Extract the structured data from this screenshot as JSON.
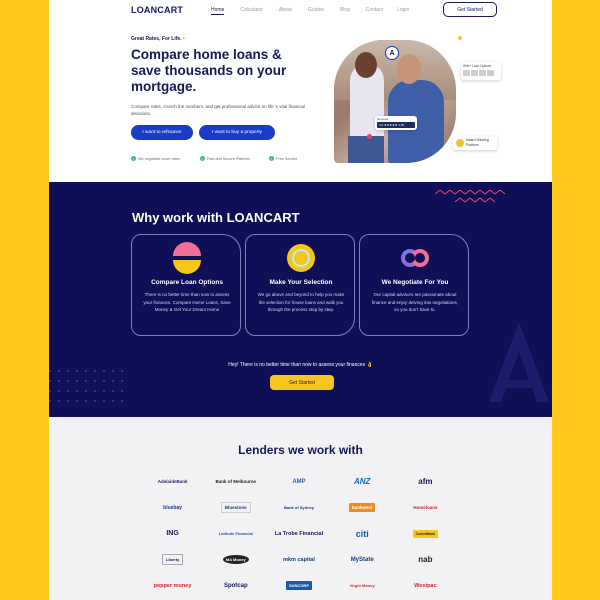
{
  "nav": {
    "logo": "LOANCART",
    "links": [
      "Home",
      "Calculator",
      "About",
      "Guides",
      "Blog",
      "Contact"
    ],
    "login": "Login",
    "cta": "Get Started"
  },
  "hero": {
    "tag": "Great Rates, For Life.",
    "title": "Compare home loans & save thousands on your mortgage.",
    "description": "Compare rates, crunch the numbers, and get professional advice on life 's vital financial decisions.",
    "btn_refinance": "I want to refinance",
    "btn_buy": "I want to buy a property",
    "features": [
      "We negotiate lower rates",
      "Fast and Secure Platform",
      "Free Service"
    ],
    "badge_letter": "A",
    "info_card": "With+ Loan Options",
    "review_label": "Reviews",
    "review_score": "4.9 ★★★★★ 1.3K",
    "award_text": "Award Winning Platform"
  },
  "why": {
    "title": "Why work with LOANCART",
    "cards": [
      {
        "title": "Compare Loan Options",
        "desc": "There is no better time than now to assess your finances. Compare Home Loans, Save Money & Get Your Dream Home"
      },
      {
        "title": "Make Your Selection",
        "desc": "We go above and beyond to help you make the selection for house loans and walk you through the process step by step."
      },
      {
        "title": "We Negotiate For You",
        "desc": "Our capital advisors are passionate about finance and enjoy delving into negotiations, so you don't have to."
      }
    ],
    "note": "Hey! There is no better time than now to assess your finances 👌",
    "cta": "Get Started"
  },
  "lenders": {
    "title": "Lenders we work with",
    "items": [
      "AdelaideBank",
      "Bank of Melbourne",
      "AMP",
      "ANZ",
      "afm",
      "bluebay",
      "Bluestone",
      "Bank of Sydney",
      "bankwest",
      "Homeloans",
      "ING",
      "Latitude Financial",
      "La Trobe Financial",
      "citi",
      "CommBank",
      "Liberty",
      "MA Money",
      "mkm capital",
      "MyState",
      "nab",
      "pepper money",
      "Spotcap",
      "SUNCORP",
      "Virgin Money",
      "Westpac"
    ]
  }
}
